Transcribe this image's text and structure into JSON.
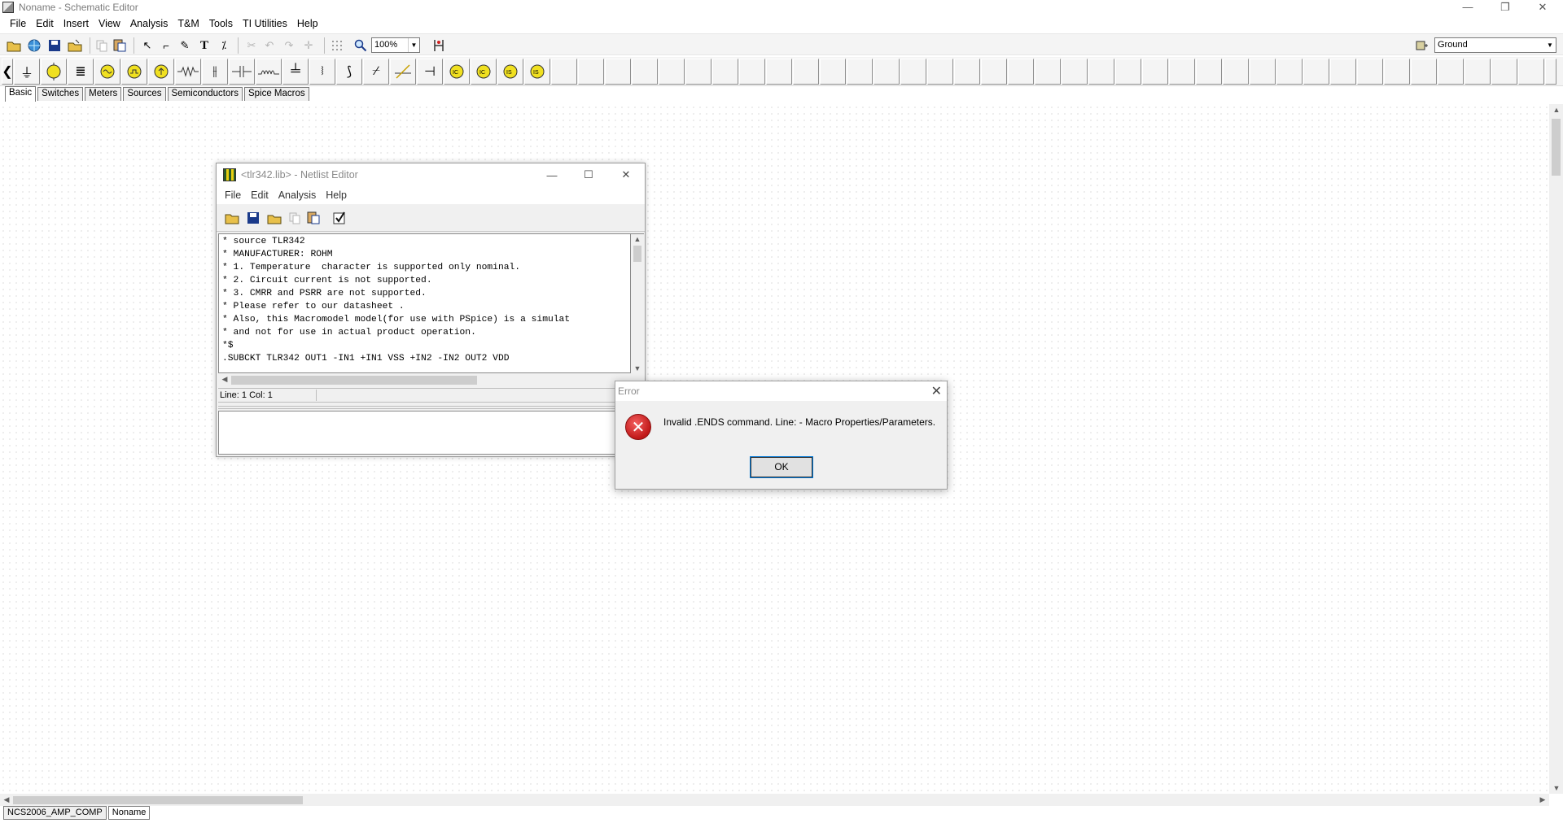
{
  "window": {
    "title": "Noname - Schematic Editor",
    "controls": {
      "minimize": "—",
      "restore": "❐",
      "close": "✕"
    }
  },
  "menubar": [
    "File",
    "Edit",
    "Insert",
    "View",
    "Analysis",
    "T&M",
    "Tools",
    "TI Utilities",
    "Help"
  ],
  "toolbar": {
    "zoom_value": "100%",
    "ground_value": "Ground"
  },
  "palette_tabs": [
    "Basic",
    "Switches",
    "Meters",
    "Sources",
    "Semiconductors",
    "Spice Macros"
  ],
  "active_palette_tab": "Basic",
  "bottom_tabs": [
    "NCS2006_AMP_COMP",
    "Noname"
  ],
  "active_bottom_tab": "Noname",
  "netlist_editor": {
    "title": "<tlr342.lib> - Netlist Editor",
    "menu": [
      "File",
      "Edit",
      "Analysis",
      "Help"
    ],
    "text": "* source TLR342\n* MANUFACTURER: ROHM\n* 1. Temperature  character is supported only nominal.\n* 2. Circuit current is not supported.\n* 3. CMRR and PSRR are not supported.\n* Please refer to our datasheet .\n* Also, this Macromodel model(for use with PSpice) is a simulat\n* and not for use in actual product operation.\n*$\n.SUBCKT TLR342 OUT1 -IN1 +IN1 VSS +IN2 -IN2 OUT2 VDD",
    "status": "Line: 1 Col: 1"
  },
  "error_dialog": {
    "title": "Error",
    "message": "Invalid .ENDS command. Line:  - Macro Properties/Parameters.",
    "ok_label": "OK",
    "icon": "error-icon"
  }
}
